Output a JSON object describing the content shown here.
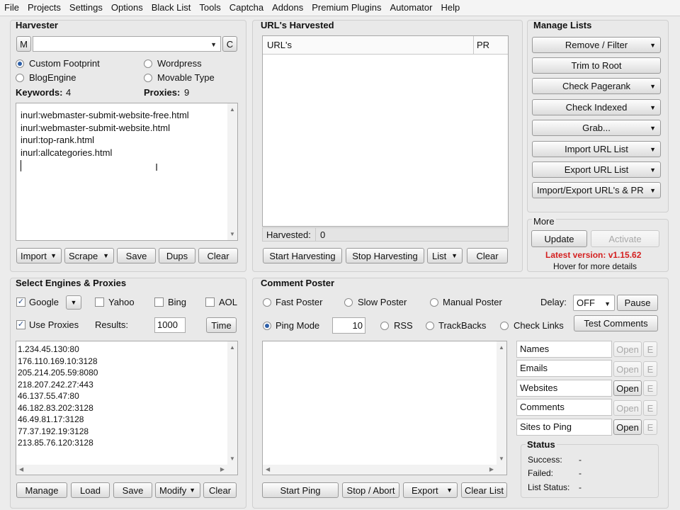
{
  "menu": [
    "File",
    "Projects",
    "Settings",
    "Options",
    "Black List",
    "Tools",
    "Captcha",
    "Addons",
    "Premium Plugins",
    "Automator",
    "Help"
  ],
  "harvester": {
    "title": "Harvester",
    "m_label": "M",
    "c_label": "C",
    "radios": {
      "custom_footprint": "Custom Footprint",
      "wordpress": "Wordpress",
      "blogengine": "BlogEngine",
      "movable_type": "Movable Type"
    },
    "keywords_label": "Keywords:",
    "keywords_count": "4",
    "proxies_label": "Proxies:",
    "proxies_count": "9",
    "footprints": [
      "inurl:webmaster-submit-website-free.html",
      "inurl:webmaster-submit-website.html",
      "inurl:top-rank.html",
      "inurl:allcategories.html"
    ],
    "buttons": {
      "import": "Import",
      "scrape": "Scrape",
      "save": "Save",
      "dups": "Dups",
      "clear": "Clear"
    }
  },
  "urls": {
    "title": "URL's Harvested",
    "col_url": "URL's",
    "col_pr": "PR",
    "harvested_label": "Harvested:",
    "harvested_count": "0",
    "buttons": {
      "start": "Start Harvesting",
      "stop": "Stop Harvesting",
      "list": "List",
      "clear": "Clear"
    }
  },
  "manage": {
    "title": "Manage Lists",
    "buttons": {
      "remove_filter": "Remove / Filter",
      "trim": "Trim to Root",
      "pagerank": "Check Pagerank",
      "indexed": "Check Indexed",
      "grab": "Grab...",
      "import": "Import URL List",
      "export": "Export URL List",
      "import_export": "Import/Export URL's & PR"
    }
  },
  "more": {
    "title": "More",
    "update": "Update",
    "activate": "Activate",
    "latest": "Latest version: v1.15.62",
    "hover": "Hover for more details",
    "latest_color": "#d42020"
  },
  "engines": {
    "title": "Select Engines & Proxies",
    "google": "Google",
    "yahoo": "Yahoo",
    "bing": "Bing",
    "aol": "AOL",
    "use_proxies": "Use Proxies",
    "results_label": "Results:",
    "results_value": "1000",
    "time": "Time",
    "proxies": [
      "1.234.45.130:80",
      "176.110.169.10:3128",
      "205.214.205.59:8080",
      "218.207.242.27:443",
      "46.137.55.47:80",
      "46.182.83.202:3128",
      "46.49.81.17:3128",
      "77.37.192.19:3128",
      "213.85.76.120:3128"
    ],
    "buttons": {
      "manage": "Manage",
      "load": "Load",
      "save": "Save",
      "modify": "Modify",
      "clear": "Clear"
    }
  },
  "poster": {
    "title": "Comment Poster",
    "fast": "Fast Poster",
    "slow": "Slow Poster",
    "manual": "Manual Poster",
    "delay_label": "Delay:",
    "delay_value": "OFF",
    "pause": "Pause",
    "ping": "Ping Mode",
    "ping_value": "10",
    "rss": "RSS",
    "trackbacks": "TrackBacks",
    "checklinks": "Check Links",
    "test_comments": "Test Comments",
    "lists": [
      {
        "label": "Names",
        "open": "Open",
        "e": "E",
        "open_enabled": false
      },
      {
        "label": "Emails",
        "open": "Open",
        "e": "E",
        "open_enabled": false
      },
      {
        "label": "Websites",
        "open": "Open",
        "e": "E",
        "open_enabled": true
      },
      {
        "label": "Comments",
        "open": "Open",
        "e": "E",
        "open_enabled": false
      },
      {
        "label": "Sites to Ping",
        "open": "Open",
        "e": "E",
        "open_enabled": true
      }
    ],
    "status": {
      "title": "Status",
      "success_label": "Success:",
      "success_value": "-",
      "failed_label": "Failed:",
      "failed_value": "-",
      "list_label": "List Status:",
      "list_value": "-"
    },
    "buttons": {
      "start_ping": "Start Ping",
      "stop_abort": "Stop / Abort",
      "export": "Export",
      "clear_list": "Clear List"
    }
  },
  "icons": {
    "dropdown": "chevron-down-icon",
    "text_cursor": "text-cursor-icon"
  }
}
